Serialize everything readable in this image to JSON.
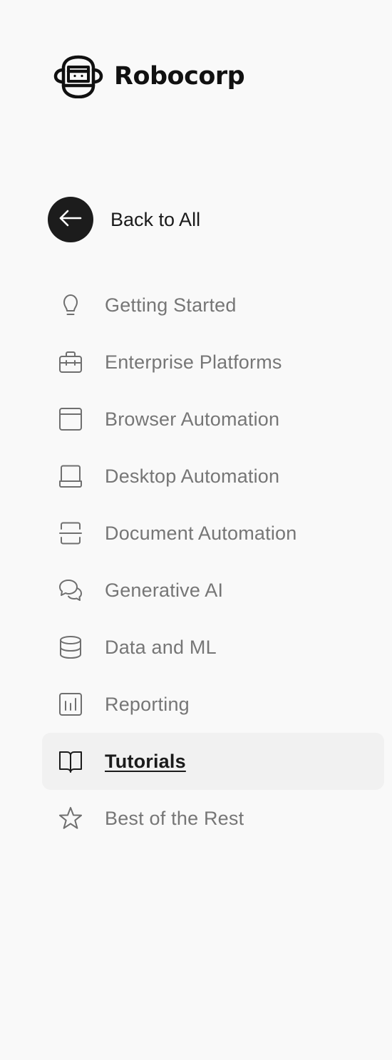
{
  "brand": {
    "name": "Robocorp",
    "logo_icon": "monkey-face-icon"
  },
  "back": {
    "label": "Back to All",
    "icon": "arrow-left-icon"
  },
  "nav": {
    "active": "Tutorials",
    "items": [
      {
        "label": "Getting Started",
        "icon": "lightbulb-icon"
      },
      {
        "label": "Enterprise Platforms",
        "icon": "briefcase-icon"
      },
      {
        "label": "Browser Automation",
        "icon": "browser-window-icon"
      },
      {
        "label": "Desktop Automation",
        "icon": "laptop-icon"
      },
      {
        "label": "Document Automation",
        "icon": "document-scan-icon"
      },
      {
        "label": "Generative AI",
        "icon": "chat-bubbles-icon"
      },
      {
        "label": "Data and ML",
        "icon": "database-icon"
      },
      {
        "label": "Reporting",
        "icon": "bar-chart-icon"
      },
      {
        "label": "Tutorials",
        "icon": "open-book-icon"
      },
      {
        "label": "Best of the Rest",
        "icon": "star-icon"
      }
    ]
  },
  "colors": {
    "background": "#f9f9f9",
    "text_primary": "#1b1b1b",
    "text_muted": "#767676",
    "active_bg": "#f1f1f1"
  }
}
